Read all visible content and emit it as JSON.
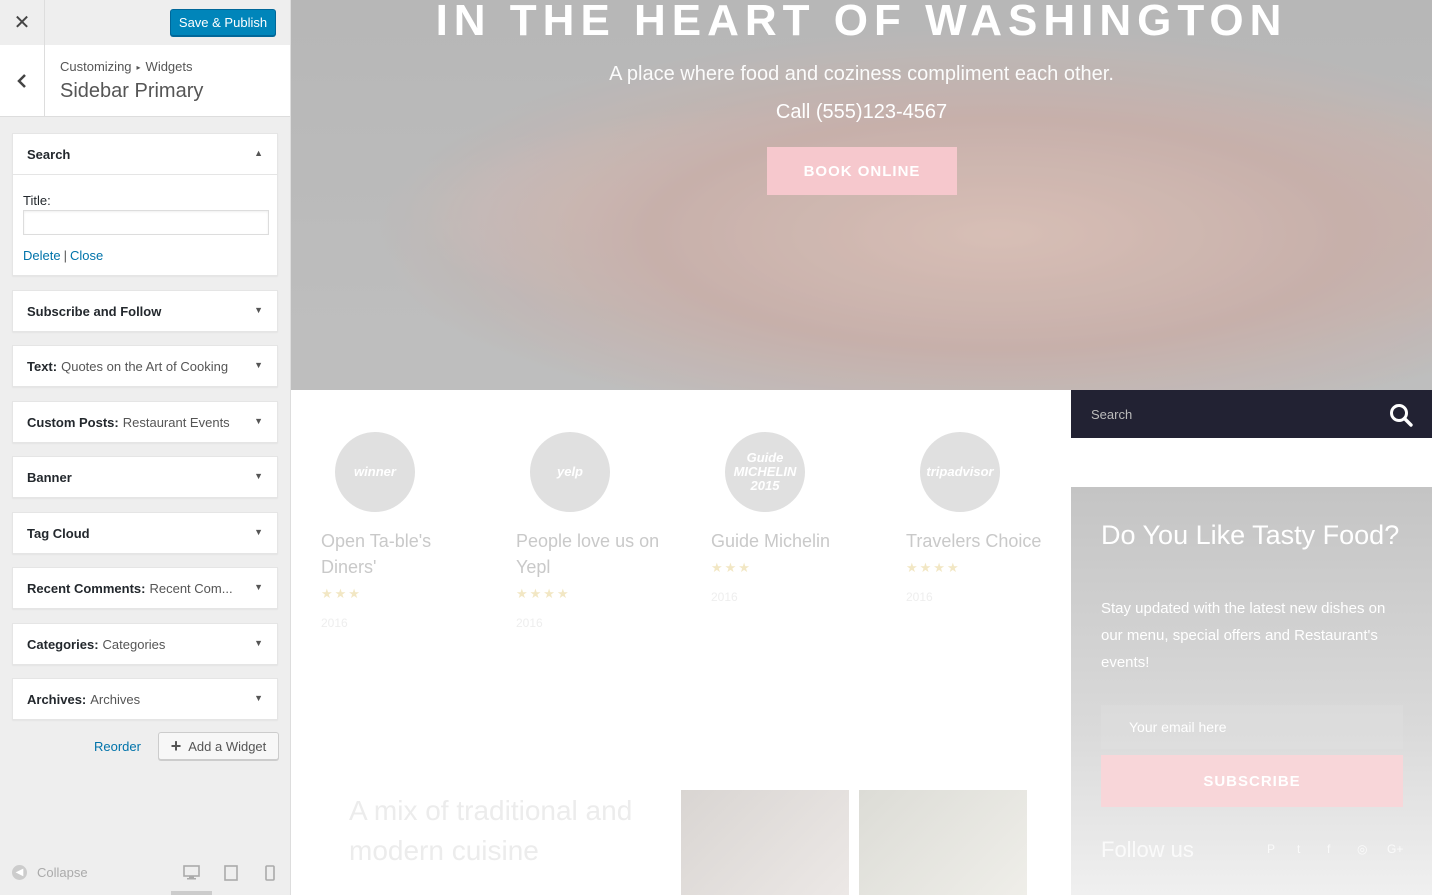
{
  "customizer": {
    "close_icon": "close-icon",
    "publish_label": "Save & Publish",
    "back_icon": "chevron-left-icon",
    "breadcrumb": {
      "root": "Customizing",
      "separator": "▸",
      "current": "Widgets"
    },
    "section_title": "Sidebar Primary",
    "search_widget": {
      "name": "Search",
      "title_label": "Title:",
      "title_value": "",
      "delete_label": "Delete",
      "close_label": "Close"
    },
    "widgets": [
      {
        "name": "Subscribe and Follow",
        "subtitle": ""
      },
      {
        "name": "Text:",
        "subtitle": "Quotes on the Art of Cooking"
      },
      {
        "name": "Custom Posts:",
        "subtitle": "Restaurant Events"
      },
      {
        "name": "Banner",
        "subtitle": ""
      },
      {
        "name": "Tag Cloud",
        "subtitle": ""
      },
      {
        "name": "Recent Comments:",
        "subtitle": "Recent Com..."
      },
      {
        "name": "Categories:",
        "subtitle": "Categories"
      },
      {
        "name": "Archives:",
        "subtitle": "Archives"
      }
    ],
    "reorder_label": "Reorder",
    "add_widget_label": "Add a Widget",
    "collapse_label": "Collapse",
    "devices": [
      "desktop-icon",
      "tablet-icon",
      "mobile-icon"
    ]
  },
  "preview": {
    "hero": {
      "title": "IN THE HEART OF WASHINGTON",
      "subtitle": "A place where food and coziness compliment each other.",
      "phone": "Call (555)123-4567",
      "book_label": "BOOK ONLINE"
    },
    "awards": [
      {
        "badge": "winner",
        "name": "Open Ta-ble's Diners'",
        "stars": "★★★",
        "year": "2016"
      },
      {
        "badge": "yelp",
        "name": "People love us on Yepl",
        "stars": "★★★★",
        "year": "2016"
      },
      {
        "badge": "Guide MICHELIN 2015",
        "name": "Guide Michelin",
        "stars": "★★★",
        "year": "2016"
      },
      {
        "badge": "tripadvisor",
        "name": "Travelers Choice",
        "stars": "★★★★",
        "year": "2016"
      }
    ],
    "search_placeholder": "Search",
    "subscribe": {
      "title": "Do You Like Tasty Food?",
      "description": "Stay updated with the latest new dishes on our menu, special offers and Restaurant's events!",
      "email_placeholder": "Your email here",
      "button_label": "SUBSCRIBE",
      "follow_label": "Follow us",
      "social_icons": [
        "pinterest-icon",
        "twitter-icon",
        "facebook-icon",
        "instagram-icon",
        "google-plus-icon"
      ]
    },
    "mix_title": "A mix of traditional and modern cuisine"
  },
  "colors": {
    "primary_button": "#0085ba",
    "link": "#0073aa",
    "search_bar": "#222233",
    "accent_pink": "#f6c8cd"
  }
}
